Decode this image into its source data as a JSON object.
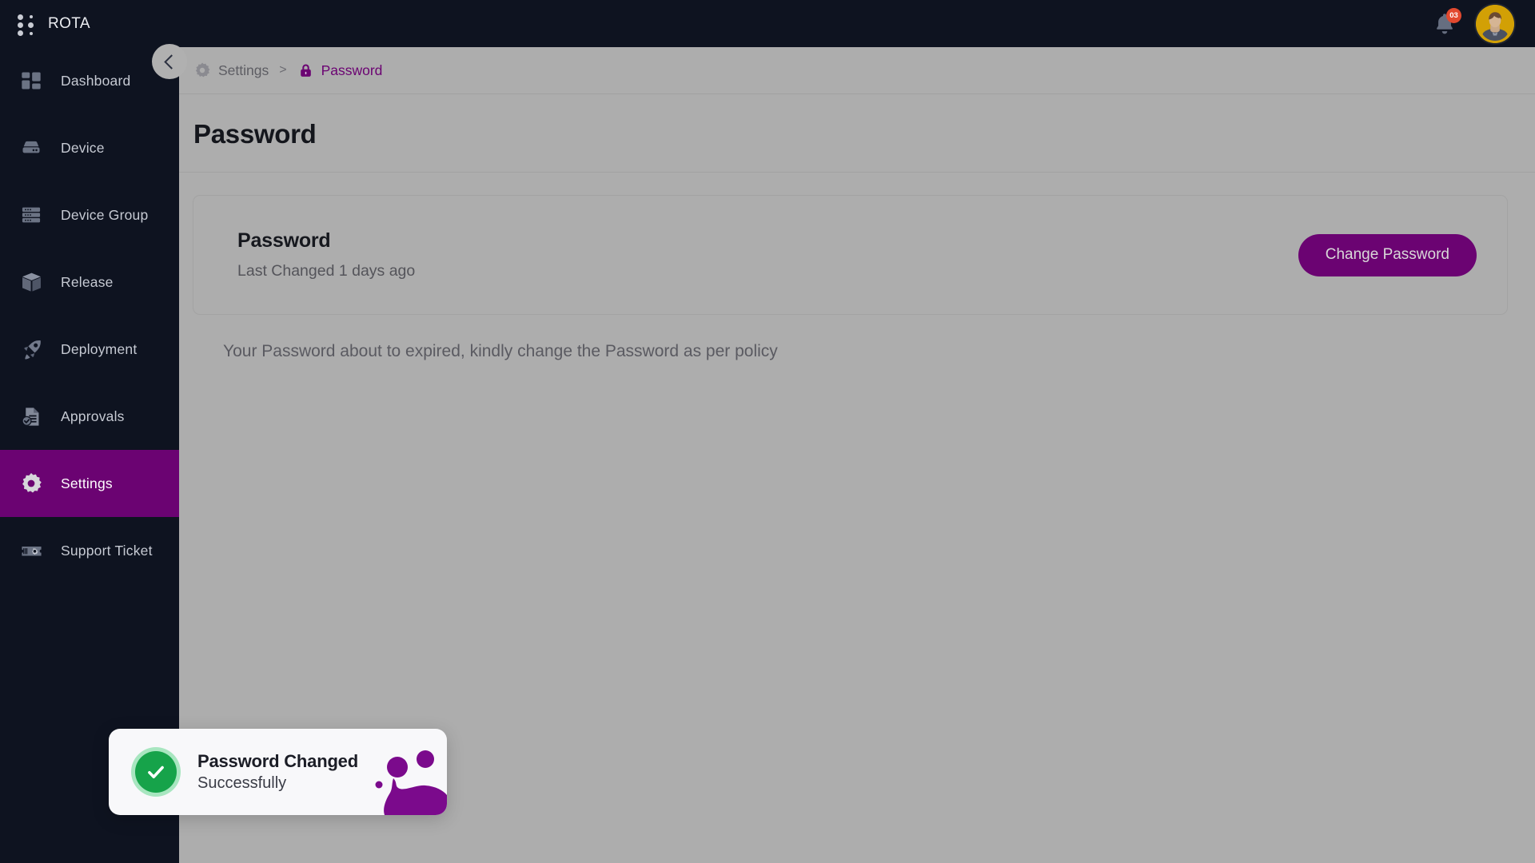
{
  "app": {
    "name": "ROTA",
    "logo_icon": "dot-grid-icon"
  },
  "header": {
    "notifications": {
      "icon": "bell-icon",
      "badge_count": "03"
    },
    "avatar": {
      "icon": "user-avatar",
      "background_color": "#d2a005"
    }
  },
  "sidebar": {
    "collapse_toggle": {
      "icon": "chevron-left-icon"
    },
    "items": [
      {
        "label": "Dashboard",
        "icon": "dashboard-grid-icon",
        "active": false
      },
      {
        "label": "Device",
        "icon": "device-server-icon",
        "active": false
      },
      {
        "label": "Device Group",
        "icon": "device-group-icon",
        "active": false
      },
      {
        "label": "Release",
        "icon": "box-cube-icon",
        "active": false
      },
      {
        "label": "Deployment",
        "icon": "rocket-icon",
        "active": false
      },
      {
        "label": "Approvals",
        "icon": "document-check-icon",
        "active": false
      },
      {
        "label": "Settings",
        "icon": "gear-icon",
        "active": true
      },
      {
        "label": "Support Ticket",
        "icon": "ticket-gear-icon",
        "active": false
      }
    ],
    "active_background": "#6b0372"
  },
  "breadcrumb": {
    "parent_icon": "gear-icon",
    "parent": "Settings",
    "separator": ">",
    "current_icon": "lock-icon",
    "current": "Password"
  },
  "main": {
    "page_title": "Password",
    "card": {
      "title": "Password",
      "subtitle": "Last Changed 1 days ago",
      "action_label": "Change Password",
      "action_color": "#6b0372"
    },
    "notice": "Your Password about to expired, kindly change the Password as per policy"
  },
  "toast": {
    "status_icon": "check-circle-icon",
    "status_color": "#16a34a",
    "title": "Password Changed",
    "subtitle": "Successfully",
    "decoration_icon": "purple-blob-decoration",
    "decoration_color": "#7b0a8c"
  }
}
